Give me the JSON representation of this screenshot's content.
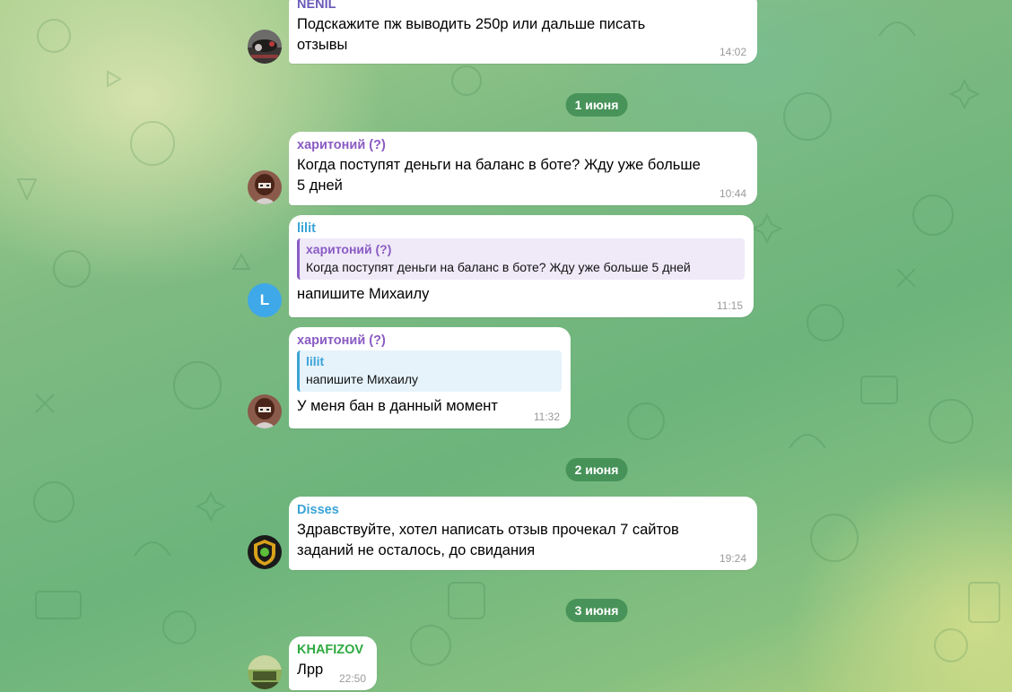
{
  "messages": [
    {
      "sender": "NENIL",
      "sender_color": "#6a5ab8",
      "text": "Подскажите пж выводить 250р или дальше писать\nотзывы",
      "time": "14:02"
    },
    {
      "sender": "харитоний (?)",
      "sender_color": "#8a5bc4",
      "text": "Когда поступят деньги на баланс в боте? Жду уже больше\n5 дней",
      "time": "10:44"
    },
    {
      "sender": "lilit",
      "sender_color": "#3aa3d6",
      "reply_name": "харитоний (?)",
      "reply_text": "Когда поступят деньги на баланс в боте? Жду уже больше 5 дней",
      "text": "напишите Михаилу",
      "time": "11:15",
      "avatar_letter": "L"
    },
    {
      "sender": "харитоний (?)",
      "sender_color": "#8a5bc4",
      "reply_name": "lilit",
      "reply_text": "напишите Михаилу",
      "text": "У меня бан в данный момент",
      "time": "11:32"
    },
    {
      "sender": "Disses",
      "sender_color": "#3aa3d6",
      "text": "Здравствуйте, хотел написать отзыв прочекал 7 сайтов\nзаданий не осталось, до свидания",
      "time": "19:24"
    },
    {
      "sender": "KHAFIZOV",
      "sender_color": "#2eaa3f",
      "text": "Лрр",
      "time": "22:50"
    }
  ],
  "dates": [
    "1 июня",
    "2 июня",
    "3 июня"
  ]
}
